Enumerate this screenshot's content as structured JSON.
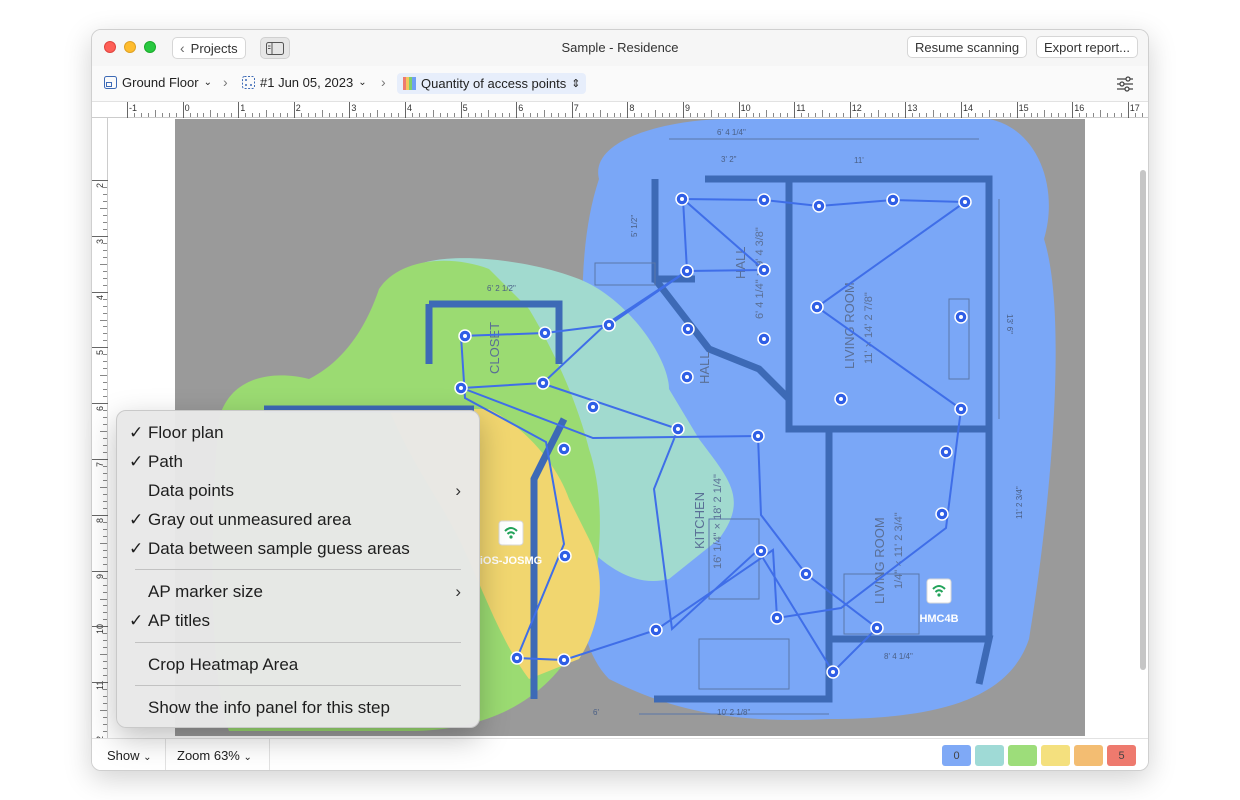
{
  "window": {
    "title": "Sample - Residence",
    "projects_label": "Projects",
    "resume_label": "Resume scanning",
    "export_label": "Export report..."
  },
  "breadcrumb": {
    "floor": "Ground Floor",
    "scan": "#1 Jun 05, 2023",
    "metric": "Quantity of access points"
  },
  "ruler": {
    "h_labels": [
      "-1",
      "0",
      "1",
      "2",
      "3",
      "4",
      "5",
      "6",
      "7",
      "8",
      "9",
      "10",
      "11",
      "12",
      "13",
      "14",
      "15",
      "16",
      "17"
    ],
    "v_labels": [
      "2",
      "3",
      "4",
      "5",
      "6",
      "7",
      "8",
      "9",
      "10",
      "11",
      "12"
    ]
  },
  "plan": {
    "room_labels": [
      "CLOSET",
      "HALL",
      "HALL",
      "LIVING ROOM",
      "KITCHEN",
      "LIVING ROOM"
    ],
    "room_dims": [
      "11' × 14' 2 7/8\"",
      "6' 4 1/4\" × 9' 4 3/8\"",
      "16' 1/4\" × 18' 2 1/4\"",
      "1/4\" × 11' 2 3/4\""
    ],
    "dimension_labels": [
      "6' 4 1/4\"",
      "11'",
      "6' 2 1/2\"",
      "10' 2 1/8\"",
      "6'",
      "8' 4 1/4\"",
      "13' 6\"",
      "11' 2 3/4\"",
      "5' 1/2\"",
      "3' 2\""
    ],
    "access_points": [
      {
        "name": "iOS-JOSMG"
      },
      {
        "name": "HMC4B"
      }
    ]
  },
  "menu": {
    "items": [
      {
        "label": "Floor plan",
        "checked": true,
        "submenu": false
      },
      {
        "label": "Path",
        "checked": true,
        "submenu": false
      },
      {
        "label": "Data points",
        "checked": false,
        "submenu": true
      },
      {
        "label": "Gray out unmeasured area",
        "checked": true,
        "submenu": false
      },
      {
        "label": "Data between sample guess areas",
        "checked": true,
        "submenu": false
      },
      {
        "label": "AP marker size",
        "checked": false,
        "submenu": true
      },
      {
        "label": "AP titles",
        "checked": true,
        "submenu": false
      },
      {
        "label": "Crop Heatmap Area",
        "checked": false,
        "submenu": false
      },
      {
        "label": "Show the info panel for this step",
        "checked": false,
        "submenu": false
      }
    ],
    "check_glyph": "✓",
    "arrow_glyph": "›"
  },
  "bottom": {
    "show_label": "Show",
    "zoom_label": "Zoom 63%",
    "legend": [
      {
        "label": "0",
        "color": "#7fa9f6"
      },
      {
        "label": "",
        "color": "#9fdad6"
      },
      {
        "label": "",
        "color": "#9ddd7a"
      },
      {
        "label": "",
        "color": "#f4e07e"
      },
      {
        "label": "",
        "color": "#f3bd72"
      },
      {
        "label": "5",
        "color": "#ee7a6e"
      }
    ]
  },
  "colors": {
    "heat_blue": "#7aa7f7",
    "heat_teal": "#a1dacf",
    "heat_green": "#9bdb72",
    "heat_yellow": "#f1d66f",
    "wall": "#3d6ab6",
    "gray": "#9a9a9a",
    "path": "#3f6ee8"
  }
}
